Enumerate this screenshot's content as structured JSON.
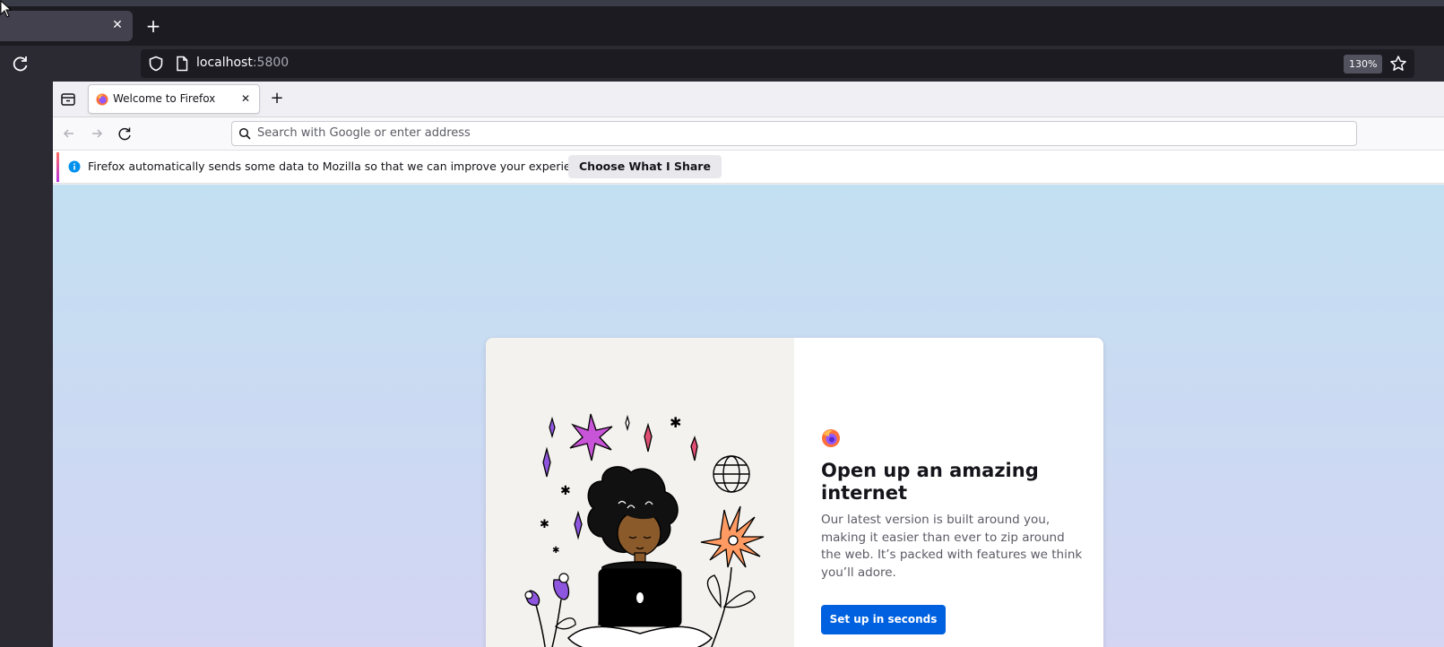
{
  "outer_browser": {
    "tab": {
      "close_label": "✕"
    },
    "new_tab_label": "+",
    "url": {
      "host": "localhost",
      "port": ":5800"
    },
    "zoom": "130%"
  },
  "inner_browser": {
    "tab": {
      "title": "Welcome to Firefox",
      "close_label": "✕"
    },
    "new_tab_label": "+",
    "search_placeholder": "Search with Google or enter address",
    "notification": {
      "message": "Firefox automatically sends some data to Mozilla so that we can improve your experience.",
      "button_label": "Choose What I Share"
    }
  },
  "welcome": {
    "headline": "Open up an amazing internet",
    "body": "Our latest version is built around you, making it easier than ever to zip around the web. It’s packed with features we think you’ll adore.",
    "cta_label": "Set up in seconds"
  },
  "colors": {
    "accent": "#0061e0",
    "dark_chrome": "#1c1b22",
    "gradient_top": "#c3dff2",
    "gradient_bottom": "#d3d5f2"
  },
  "icons": [
    "reload-icon",
    "shield-icon",
    "page-icon",
    "star-icon",
    "sidebar-icon",
    "firefox-favicon",
    "back-icon",
    "forward-icon",
    "search-icon",
    "info-icon",
    "firefox-logo"
  ]
}
